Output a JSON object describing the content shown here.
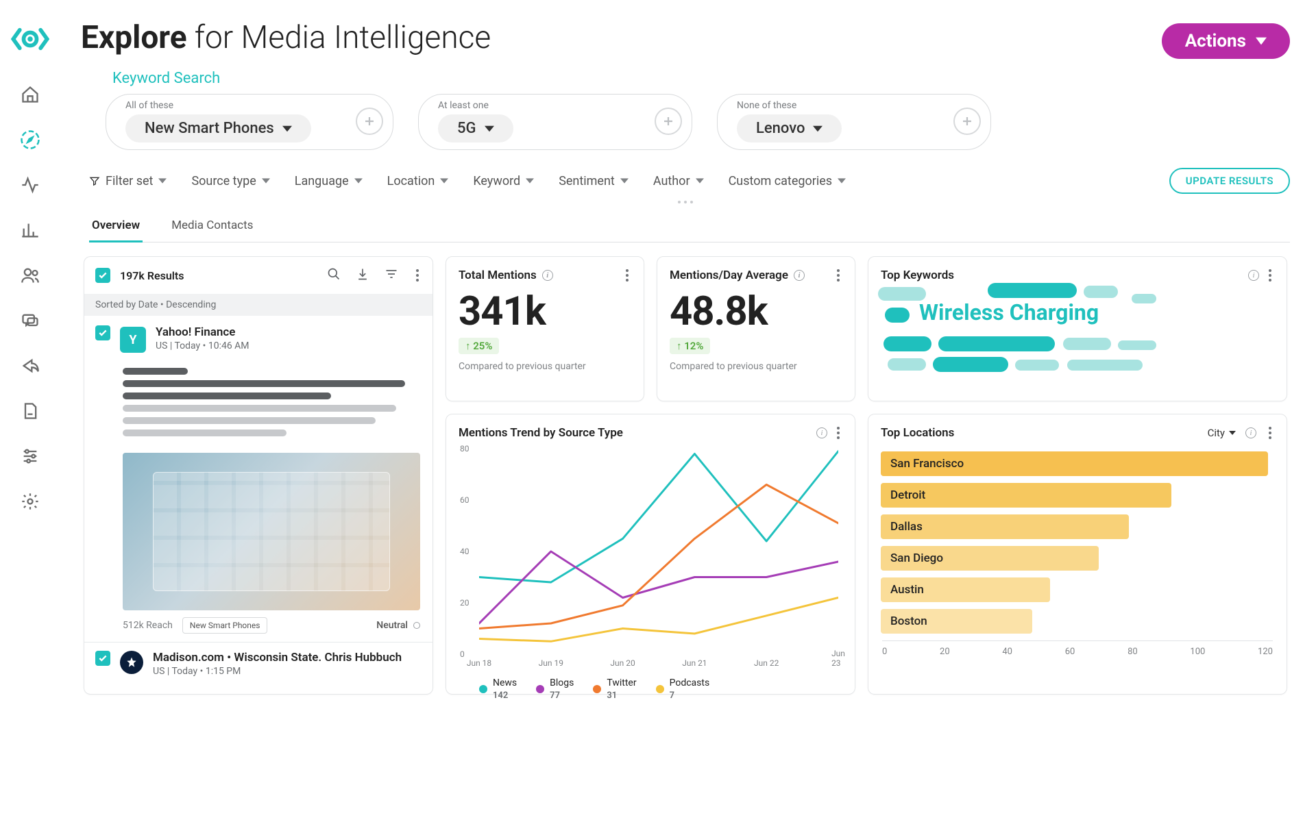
{
  "header": {
    "title_bold": "Explore",
    "title_rest": " for Media Intelligence"
  },
  "actions_label": "Actions",
  "sidebar": {
    "active_index": 1,
    "items": [
      "home",
      "compass",
      "activity",
      "bar-chart",
      "people",
      "chat",
      "share",
      "document",
      "sliders",
      "gear"
    ]
  },
  "search": {
    "label": "Keyword Search",
    "groups": {
      "all": {
        "label": "All of these",
        "chip": "New Smart Phones"
      },
      "any": {
        "label": "At least one",
        "chip": "5G"
      },
      "none": {
        "label": "None of these",
        "chip": "Lenovo"
      }
    }
  },
  "filters": [
    "Filter set",
    "Source type",
    "Language",
    "Location",
    "Keyword",
    "Sentiment",
    "Author",
    "Custom categories"
  ],
  "update_button": "UPDATE RESULTS",
  "tabs": {
    "items": [
      "Overview",
      "Media Contacts"
    ],
    "active": 0
  },
  "results": {
    "count_label": "197k Results",
    "sort_label": "Sorted by Date • Descending",
    "items": [
      {
        "source": "Yahoo! Finance",
        "meta": "US  |  Today • 10:46 AM",
        "reach": "512k Reach",
        "tag": "New Smart Phones",
        "sentiment": "Neutral",
        "avatar": "Y"
      },
      {
        "source_line": "Madison.com • Wisconsin State. Chris Hubbuch",
        "meta": "US  |  Today • 1:15 PM"
      }
    ]
  },
  "kpis": {
    "total": {
      "title": "Total Mentions",
      "value": "341k",
      "delta": "↑ 25%",
      "sub": "Compared to previous quarter"
    },
    "avg": {
      "title": "Mentions/Day Average",
      "value": "48.8k",
      "delta": "↑ 12%",
      "sub": "Compared to previous quarter"
    }
  },
  "keywords": {
    "title": "Top Keywords",
    "hero": "Wireless Charging"
  },
  "trend": {
    "title": "Mentions Trend by Source Type"
  },
  "locations": {
    "title": "Top Locations",
    "selector": "City",
    "axis": [
      "0",
      "20",
      "40",
      "60",
      "80",
      "100",
      "120"
    ]
  },
  "chart_data": [
    {
      "type": "line",
      "title": "Mentions Trend by Source Type",
      "xlabel": "",
      "ylabel": "",
      "ylim": [
        0,
        80
      ],
      "x": [
        "Jun 18",
        "Jun 19",
        "Jun 20",
        "Jun 21",
        "Jun 22",
        "Jun 23"
      ],
      "series": [
        {
          "name": "News",
          "color": "#1fc0bd",
          "values": [
            30,
            28,
            45,
            78,
            44,
            79
          ],
          "legend_value": 142
        },
        {
          "name": "Blogs",
          "color": "#a53db6",
          "values": [
            12,
            40,
            22,
            30,
            30,
            36
          ],
          "legend_value": 77
        },
        {
          "name": "Twitter",
          "color": "#f07a2f",
          "values": [
            10,
            12,
            19,
            45,
            66,
            51
          ],
          "legend_value": 31
        },
        {
          "name": "Podcasts",
          "color": "#f4c43b",
          "values": [
            6,
            5,
            10,
            8,
            15,
            22
          ],
          "legend_value": 7
        }
      ]
    },
    {
      "type": "bar",
      "title": "Top Locations",
      "orientation": "horizontal",
      "xlim": [
        0,
        130
      ],
      "categories": [
        "San Francisco",
        "Detroit",
        "Dallas",
        "San Diego",
        "Austin",
        "Boston"
      ],
      "values": [
        128,
        96,
        82,
        72,
        56,
        50
      ],
      "colors": [
        "#f6c050",
        "#f6c85f",
        "#f8d178",
        "#f9d88c",
        "#fadd99",
        "#fbe2a8"
      ]
    }
  ]
}
